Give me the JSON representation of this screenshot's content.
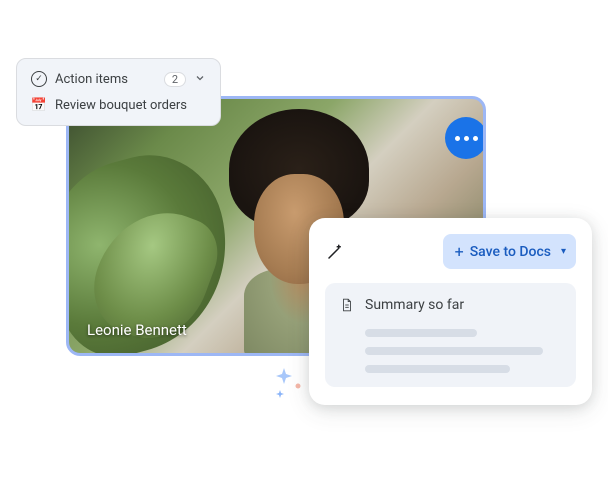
{
  "action_items": {
    "title": "Action items",
    "count": "2",
    "items": [
      {
        "icon": "📅",
        "text": "Review bouquet orders"
      }
    ]
  },
  "video": {
    "participant_name": "Leonie Bennett"
  },
  "summary_panel": {
    "save_button_label": "Save to Docs",
    "summary_title": "Summary so far"
  }
}
